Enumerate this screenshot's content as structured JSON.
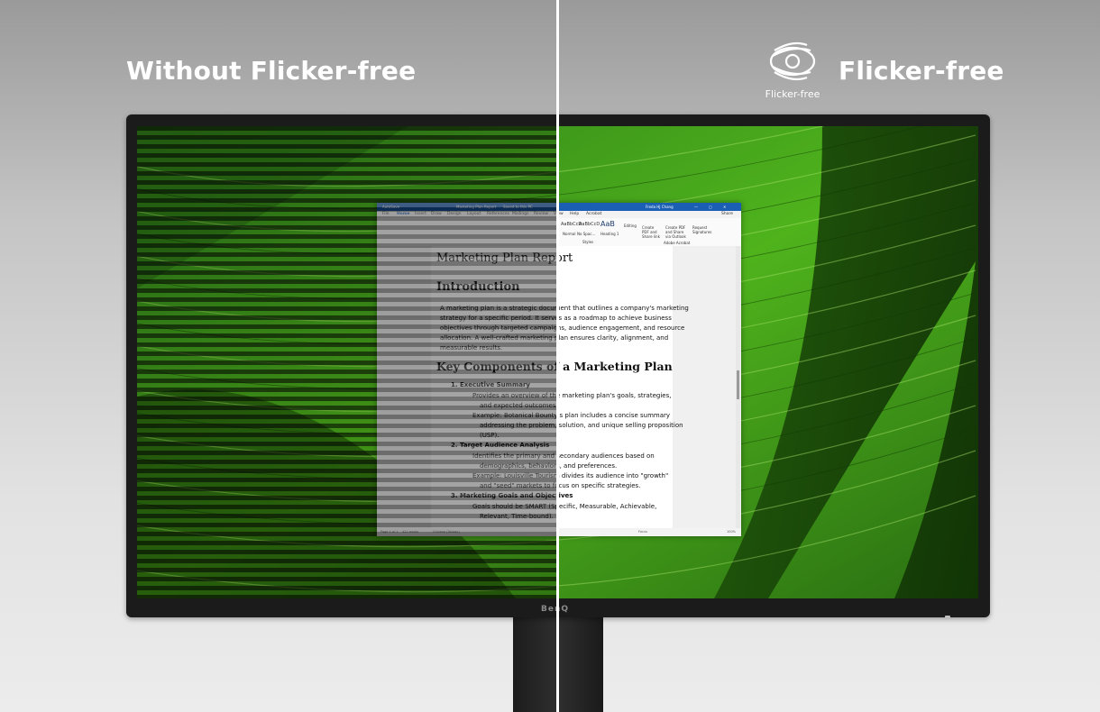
{
  "headline_left": "Without Flicker-free",
  "headline_right": "Flicker-free",
  "logo_label": "Flicker-free",
  "monitor_brand": "BenQ",
  "window": {
    "title_left": "AutoSave",
    "title_center": "Marketing Plan Report",
    "title_saved": "Saved to this PC",
    "user": "Freda HJ Chang",
    "menu": [
      "File",
      "Home",
      "Insert",
      "Draw",
      "Design",
      "Layout",
      "References",
      "Mailings",
      "Review",
      "View",
      "Help",
      "Acrobat"
    ],
    "share_label": "Share",
    "styles": [
      "Normal",
      "No Spac...",
      "Heading 1"
    ],
    "style_sample": "AaBbCcD",
    "heading_sample": "AaB",
    "styles_group": "Styles",
    "editing_label": "Editing",
    "acrobat_buttons": [
      "Create PDF and Share link",
      "Create PDF and Share via Outlook",
      "Request Signatures"
    ],
    "acrobat_group": "Adobe Acrobat",
    "status_page": "Page 1 of 1",
    "status_words": "422 words",
    "status_lang": "Chinese (Taiwan)",
    "status_focus": "Focus",
    "zoom": "100%"
  },
  "document": {
    "title": "Marketing Plan Report",
    "intro_heading": "Introduction",
    "intro_lines": [
      "A marketing plan is a strategic document that outlines a company's marketing",
      "strategy for a specific period. It serves as a roadmap to achieve business",
      "objectives through targeted campaigns, audience engagement, and resource",
      "allocation. A well-crafted marketing plan ensures clarity, alignment, and",
      "measurable results."
    ],
    "components_heading": "Key Components of a Marketing Plan",
    "items": [
      {
        "title": "1.   Executive Summary",
        "bullets": [
          "Provides an overview of the marketing plan's goals, strategies,",
          "and expected outcomes.",
          "Example: Botanical Bounty's plan includes a concise summary",
          "addressing the problem, solution, and unique selling proposition",
          "(USP)."
        ]
      },
      {
        "title": "2.   Target Audience Analysis",
        "bullets": [
          "Identifies the primary and secondary audiences based on",
          "demographics, behaviors, and preferences.",
          "Example: Louisville Tourism divides its audience into \"growth\"",
          "and \"seed\" markets to focus on specific strategies."
        ]
      },
      {
        "title": "3.   Marketing Goals and Objectives",
        "bullets": [
          "Goals should be SMART (Specific, Measurable, Achievable,",
          "Relevant, Time-bound)."
        ]
      }
    ]
  }
}
